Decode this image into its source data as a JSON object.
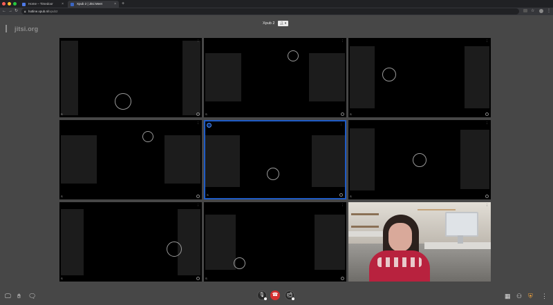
{
  "browser": {
    "tabs": [
      {
        "title": "Home – Timedoor",
        "favicon_color": "#4e7ae8"
      },
      {
        "title": "Xpub 2 | Jitsi Meet",
        "favicon_color": "#3b66c4"
      }
    ],
    "url_host": "hotline.xpub.nl",
    "url_path": "/xpub2",
    "new_tab_label": "+"
  },
  "meeting": {
    "logo_text": "jitsi.org",
    "room_name": "Xpub 2",
    "participant_count": "9",
    "active_border_color": "#1e5bc6",
    "hangup_color": "#d52f2f"
  },
  "tiles": [
    {
      "name": "S",
      "active": false
    },
    {
      "name": "S",
      "active": false
    },
    {
      "name": "S",
      "active": false
    },
    {
      "name": "S",
      "active": false
    },
    {
      "name": "S",
      "active": true
    },
    {
      "name": "S",
      "active": false
    },
    {
      "name": "S",
      "active": false
    },
    {
      "name": "S",
      "active": false
    },
    {
      "name": "S",
      "active": false,
      "camera": true
    }
  ],
  "toolbar": {
    "left_icons": [
      "screen-share-icon",
      "raise-hand-icon",
      "chat-icon"
    ],
    "center": [
      "microphone-icon",
      "hangup-icon",
      "camera-icon"
    ],
    "right_icons": [
      "tile-view-icon",
      "invite-icon",
      "security-shield-icon",
      "more-options-icon"
    ]
  }
}
